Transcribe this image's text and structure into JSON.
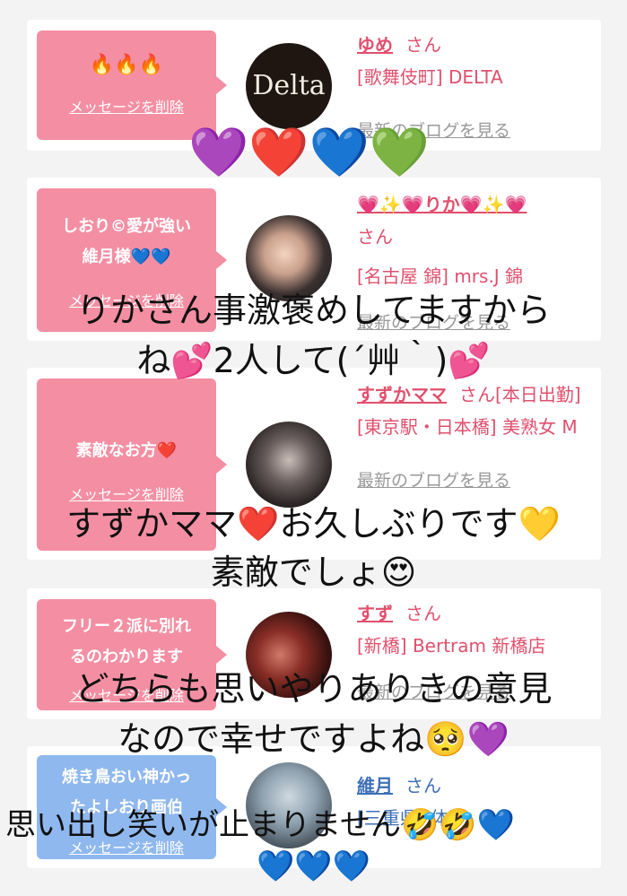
{
  "cards": [
    {
      "message": "🔥🔥🔥",
      "delete_label": "メッセージを削除",
      "avatar_text": "Delta",
      "name": "ゆめ",
      "honorific": "さん",
      "shop": "[歌舞伎町] DELTA",
      "blog_label": "最新のブログを見る"
    },
    {
      "message_line1": "しおり©愛が強い",
      "message_line2": "維月様💙💙",
      "delete_label": "メッセージを削除",
      "name": "💗✨💗りか💗✨💗",
      "honorific": "さん",
      "shop": "[名古屋 錦] mrs.J 錦",
      "blog_label": "最新のブログを見る"
    },
    {
      "message": "素敵なお方❤️",
      "delete_label": "メッセージを削除",
      "name": "すずかママ",
      "honorific": "さん[本日出勤]",
      "shop": "[東京駅・日本橋] 美熟女 M",
      "blog_label": "最新のブログを見る"
    },
    {
      "message_line1": "フリー２派に別れ",
      "message_line2": "るのわかります",
      "delete_label": "メッセージを削除",
      "name": "すず",
      "honorific": "さん",
      "shop": "[新橋] Bertram 新橋店",
      "blog_label": "最新のブログを見る"
    },
    {
      "message_line1": "焼き鳥おい神かっ",
      "message_line2": "たよしおり画伯",
      "delete_label": "メッセージを削除",
      "name": "維月",
      "honorific": "さん",
      "shop": "[三重県] 体験",
      "blog_label": ""
    }
  ],
  "overlays": {
    "hearts": "💜❤️💙💚",
    "line1": "りかさん事激褒めしてますから",
    "line2": "ね💕2人して(´艸｀)💕",
    "line3": "すずかママ❤️お久しぶりです💛",
    "line4": "素敵でしょ😍",
    "line5": "どちらも思いやりありきの意見",
    "line6": "なので幸せですよね🥺💜",
    "line7": "思い出し笑いが止まりません🤣🤣💙",
    "line8": "💙💙💙"
  },
  "colors": {
    "accent_pink": "#f48fa3",
    "accent_blue": "#8fb8ef",
    "name_pink": "#e0506d",
    "name_blue": "#3c6fb6"
  }
}
